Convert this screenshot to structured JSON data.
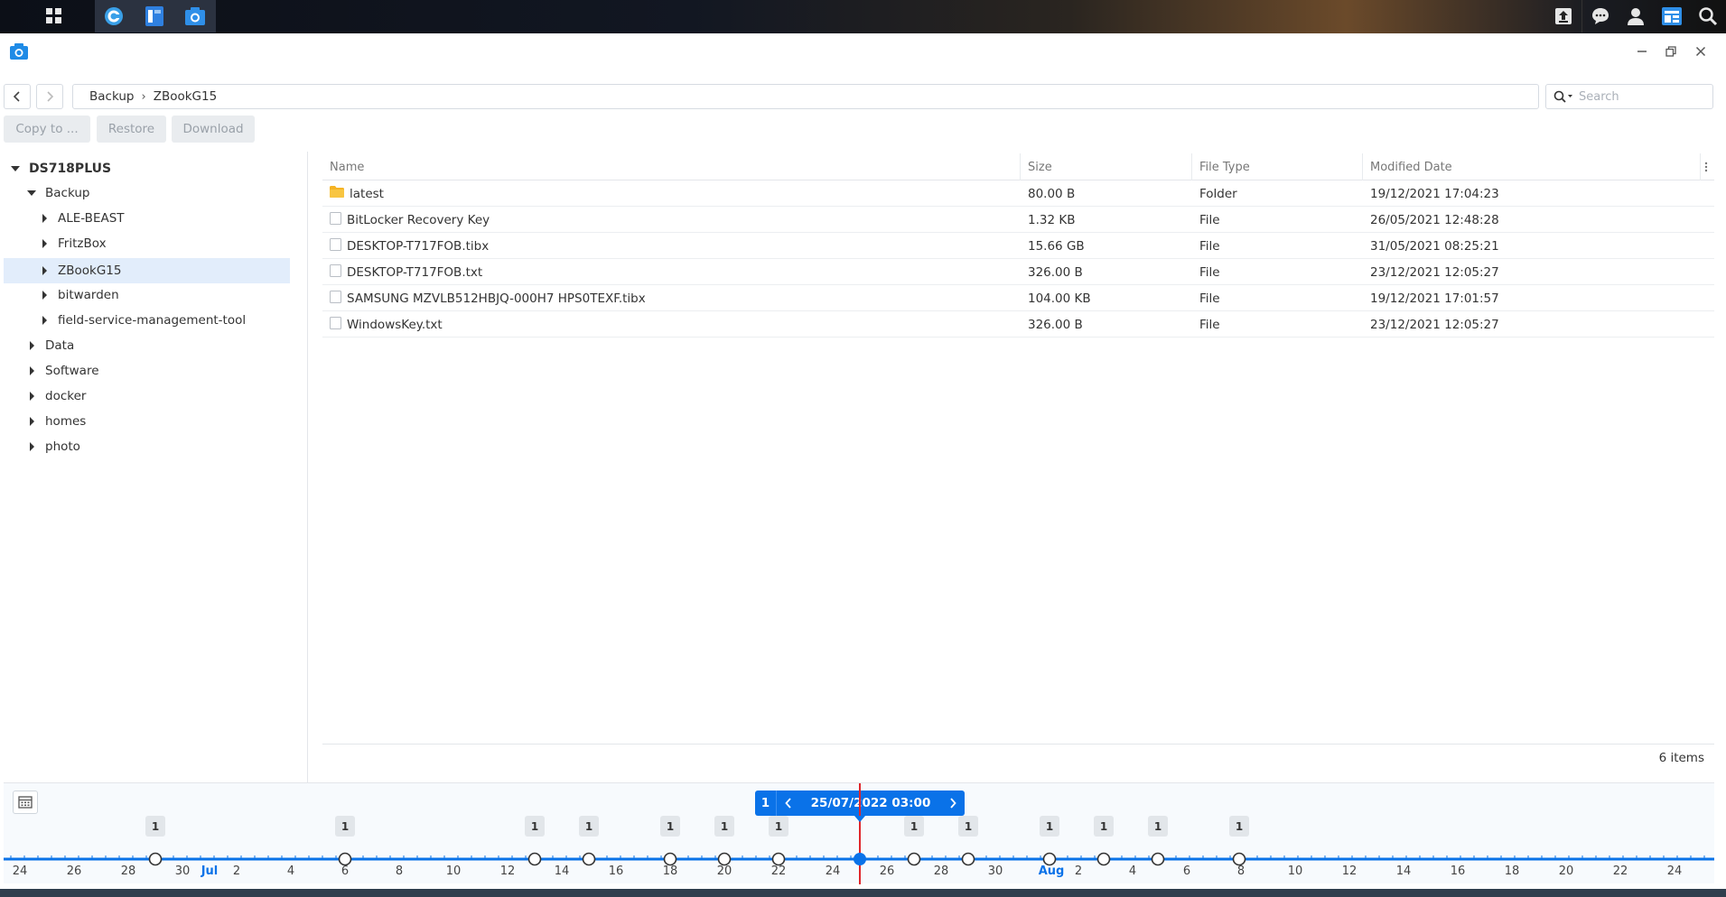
{
  "taskbar": {
    "left_icons": [
      "apps-grid-icon",
      "synology-assistant-icon",
      "file-station-icon",
      "snapshot-explorer-icon"
    ],
    "right_icons": [
      "upload-icon",
      "chat-icon",
      "user-icon",
      "widgets-icon",
      "search-icon"
    ]
  },
  "window": {
    "app_icon": "camera-icon",
    "controls": [
      "minimize-icon",
      "restore-icon",
      "close-icon"
    ]
  },
  "breadcrumb": [
    "Backup",
    "ZBookG15"
  ],
  "search": {
    "placeholder": "Search",
    "value": ""
  },
  "actions": {
    "copy_to": "Copy to ...",
    "restore": "Restore",
    "download": "Download"
  },
  "tree": {
    "root": "DS718PLUS",
    "items": [
      {
        "label": "Backup",
        "expanded": true
      },
      {
        "label": "ALE-BEAST"
      },
      {
        "label": "FritzBox"
      },
      {
        "label": "ZBookG15",
        "selected": true
      },
      {
        "label": "bitwarden"
      },
      {
        "label": "field-service-management-tool"
      },
      {
        "label": "Data"
      },
      {
        "label": "Software"
      },
      {
        "label": "docker"
      },
      {
        "label": "homes"
      },
      {
        "label": "photo"
      }
    ]
  },
  "table": {
    "columns": [
      "Name",
      "Size",
      "File Type",
      "Modified Date"
    ],
    "rows": [
      {
        "name": "latest",
        "size": "80.00 B",
        "type": "Folder",
        "modified": "19/12/2021 17:04:23",
        "icon": "folder-icon"
      },
      {
        "name": "BitLocker Recovery Key",
        "size": "1.32 KB",
        "type": "File",
        "modified": "26/05/2021 12:48:28",
        "icon": "file-icon"
      },
      {
        "name": "DESKTOP-T717FOB.tibx",
        "size": "15.66 GB",
        "type": "File",
        "modified": "31/05/2021 08:25:21",
        "icon": "file-icon"
      },
      {
        "name": "DESKTOP-T717FOB.txt",
        "size": "326.00 B",
        "type": "File",
        "modified": "23/12/2021 12:05:27",
        "icon": "file-icon"
      },
      {
        "name": "SAMSUNG MZVLB512HBJQ-000H7 HPS0TEXF.tibx",
        "size": "104.00 KB",
        "type": "File",
        "modified": "19/12/2021 17:01:57",
        "icon": "file-icon"
      },
      {
        "name": "WindowsKey.txt",
        "size": "326.00 B",
        "type": "File",
        "modified": "23/12/2021 12:05:27",
        "icon": "file-icon"
      }
    ],
    "item_count": "6 items"
  },
  "timeline": {
    "selected_count": "1",
    "selected_datetime": "25/07/2022 03:00",
    "tick_labels": [
      "24",
      "26",
      "28",
      "30",
      "Jul",
      "2",
      "4",
      "6",
      "8",
      "10",
      "12",
      "14",
      "16",
      "18",
      "20",
      "22",
      "24",
      "26",
      "28",
      "30",
      "Aug",
      "2",
      "4",
      "6",
      "8",
      "10",
      "12",
      "14",
      "16",
      "18",
      "20",
      "22",
      "24"
    ],
    "snapshot_counts": [
      "1",
      "1",
      "1",
      "1",
      "1",
      "1",
      "1",
      "1",
      "1",
      "1",
      "1",
      "1",
      "1"
    ],
    "colors": {
      "accent": "#0a72e8",
      "current_marker": "#e0262b"
    }
  }
}
